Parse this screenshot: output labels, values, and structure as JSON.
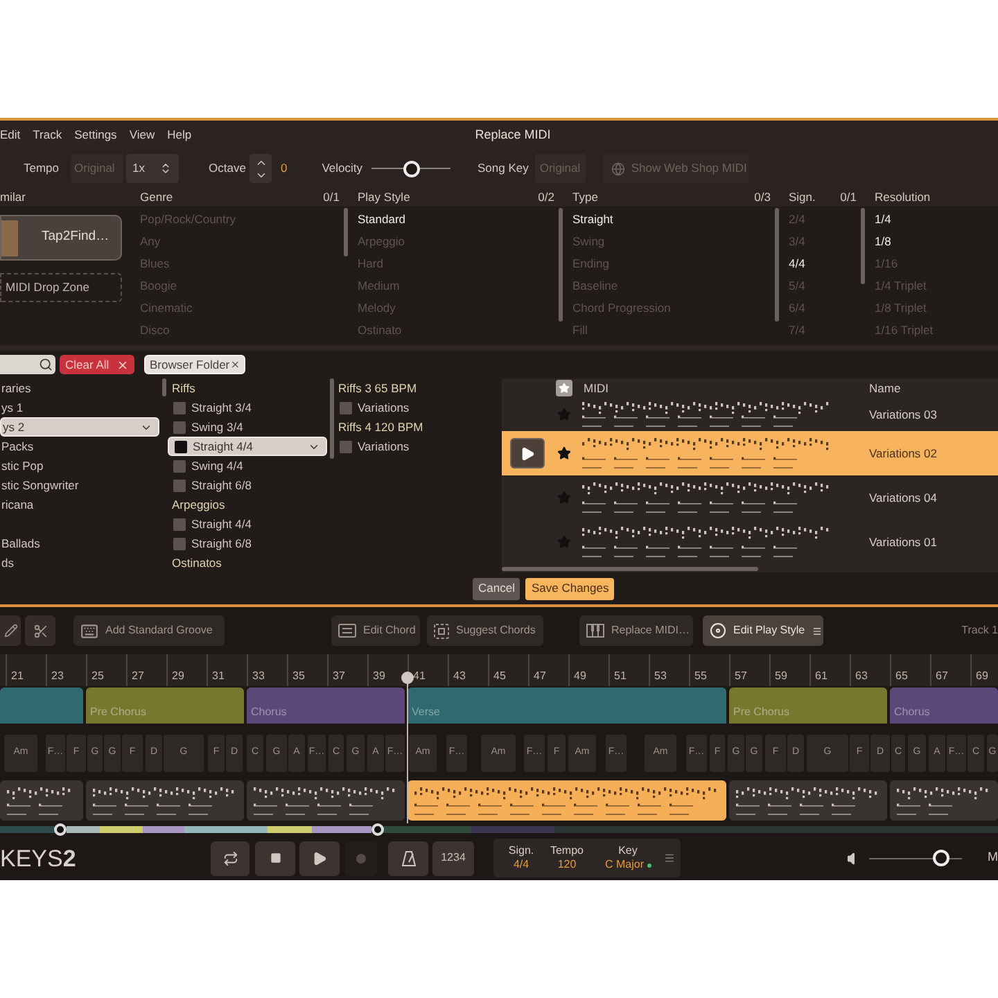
{
  "menu": [
    {
      "label": "Edit"
    },
    {
      "label": "Track"
    },
    {
      "label": "Settings"
    },
    {
      "label": "View"
    },
    {
      "label": "Help"
    }
  ],
  "window": {
    "title": "Replace MIDI"
  },
  "toolbar": {
    "tempo": {
      "label": "Tempo",
      "value": "Original",
      "disabled": true
    },
    "speed": {
      "value": "1x"
    },
    "octave": {
      "label": "Octave",
      "value": "0"
    },
    "velocity": {
      "label": "Velocity",
      "level": 0.5
    },
    "song_key": {
      "label": "Song Key",
      "value": "Original",
      "disabled": true
    },
    "web_shop_button": {
      "label": "Show Web Shop MIDI",
      "disabled": true
    }
  },
  "filters": {
    "similar": {
      "header": "milar",
      "tap_button": "Tap2Find…",
      "drop_zone": "MIDI Drop Zone"
    },
    "columns": [
      {
        "header": "Genre",
        "count": "0/1",
        "items": [
          {
            "label": "Pop/Rock/Country",
            "disabled": true
          },
          {
            "label": "Any",
            "disabled": true
          },
          {
            "label": "Blues",
            "disabled": true
          },
          {
            "label": "Boogie",
            "disabled": true
          },
          {
            "label": "Cinematic",
            "disabled": true
          },
          {
            "label": "Disco",
            "disabled": true
          }
        ]
      },
      {
        "header": "Play Style",
        "count": "0/2",
        "items": [
          {
            "label": "Standard",
            "disabled": false
          },
          {
            "label": "Arpeggio",
            "disabled": true
          },
          {
            "label": "Hard",
            "disabled": true
          },
          {
            "label": "Medium",
            "disabled": true
          },
          {
            "label": "Melody",
            "disabled": true
          },
          {
            "label": "Ostinato",
            "disabled": true
          }
        ]
      },
      {
        "header": "Type",
        "count": "0/3",
        "items": [
          {
            "label": "Straight",
            "disabled": false
          },
          {
            "label": "Swing",
            "disabled": true
          },
          {
            "label": "Ending",
            "disabled": true
          },
          {
            "label": "Baseline",
            "disabled": true
          },
          {
            "label": "Chord Progression",
            "disabled": true
          },
          {
            "label": "Fill",
            "disabled": true
          }
        ]
      },
      {
        "header": "Sign.",
        "count": "0/1",
        "items": [
          {
            "label": "2/4",
            "disabled": true
          },
          {
            "label": "3/4",
            "disabled": true
          },
          {
            "label": "4/4",
            "disabled": false
          },
          {
            "label": "5/4",
            "disabled": true
          },
          {
            "label": "6/4",
            "disabled": true
          },
          {
            "label": "7/4",
            "disabled": true
          }
        ]
      },
      {
        "header": "Resolution",
        "items": [
          {
            "label": "1/4",
            "disabled": false
          },
          {
            "label": "1/8",
            "disabled": false
          },
          {
            "label": "1/16",
            "disabled": true
          },
          {
            "label": "1/4 Triplet",
            "disabled": true
          },
          {
            "label": "1/8 Triplet",
            "disabled": true
          },
          {
            "label": "1/16 Triplet",
            "disabled": true
          }
        ]
      }
    ]
  },
  "browser": {
    "clear_button": "Clear All",
    "folder_tag": "Browser Folder",
    "columns": [
      {
        "items": [
          {
            "kind": "item",
            "label": "raries",
            "selected": false
          },
          {
            "kind": "item",
            "label": "ys 1",
            "selected": false
          },
          {
            "kind": "item",
            "label": "ys 2",
            "selected": true
          },
          {
            "kind": "item",
            "label": "Packs",
            "selected": false
          },
          {
            "kind": "item",
            "label": "stic Pop",
            "selected": false
          },
          {
            "kind": "item",
            "label": "stic Songwriter",
            "selected": false
          },
          {
            "kind": "item",
            "label": "ricana",
            "selected": false
          },
          {
            "kind": "item",
            "label": "Ballads",
            "selected": false
          },
          {
            "kind": "item",
            "label": "ds",
            "selected": false
          }
        ]
      },
      {
        "items": [
          {
            "kind": "header",
            "label": "Riffs"
          },
          {
            "kind": "folder",
            "label": "Straight 3/4",
            "selected": false
          },
          {
            "kind": "folder",
            "label": "Swing 3/4",
            "selected": false
          },
          {
            "kind": "folder",
            "label": "Straight 4/4",
            "selected": true
          },
          {
            "kind": "folder",
            "label": "Swing 4/4",
            "selected": false
          },
          {
            "kind": "folder",
            "label": "Straight 6/8",
            "selected": false
          },
          {
            "kind": "header",
            "label": "Arpeggios"
          },
          {
            "kind": "folder",
            "label": "Straight 4/4",
            "selected": false
          },
          {
            "kind": "folder",
            "label": "Straight 6/8",
            "selected": false
          },
          {
            "kind": "header",
            "label": "Ostinatos"
          }
        ]
      },
      {
        "items": [
          {
            "kind": "header",
            "label": "Riffs 3 65 BPM"
          },
          {
            "kind": "folder",
            "label": "Variations",
            "selected": false
          },
          {
            "kind": "header",
            "label": "Riffs 4 120 BPM"
          },
          {
            "kind": "folder",
            "label": "Variations",
            "selected": false
          }
        ]
      }
    ]
  },
  "midi_table": {
    "columns": [
      "MIDI",
      "Name"
    ],
    "rows": [
      {
        "name": "Variations 03",
        "selected": false
      },
      {
        "name": "Variations 02",
        "selected": true
      },
      {
        "name": "Variations 04",
        "selected": false
      },
      {
        "name": "Variations 01",
        "selected": false
      }
    ]
  },
  "dialog_buttons": [
    {
      "label": "Cancel",
      "kind": "secondary"
    },
    {
      "label": "Save Changes",
      "kind": "primary"
    }
  ],
  "main_toolbar": {
    "buttons": [
      {
        "label": "Add Standard Groove",
        "kind": "groove",
        "selected": false
      },
      {
        "label": "Edit Chord",
        "kind": "chord",
        "selected": false
      },
      {
        "label": "Suggest Chords",
        "kind": "suggest",
        "selected": false
      },
      {
        "label": "Replace MIDI…",
        "kind": "replace",
        "selected": false
      },
      {
        "label": "Edit Play Style",
        "kind": "style",
        "selected": true
      }
    ],
    "track_label": "Track 1"
  },
  "timeline": {
    "bars": [
      "21",
      "23",
      "25",
      "27",
      "29",
      "31",
      "33",
      "35",
      "37",
      "39",
      "41",
      "43",
      "45",
      "47",
      "49",
      "51",
      "53",
      "55",
      "57",
      "59",
      "61",
      "63",
      "65",
      "67",
      "69"
    ],
    "sections": [
      {
        "color": "#2e6a70"
      },
      {
        "label": "Pre Chorus",
        "color": "#77772f"
      },
      {
        "label": "Chorus",
        "color": "#5c4878"
      },
      {
        "label": "Verse",
        "color": "#2e6a70"
      },
      {
        "label": "Pre Chorus",
        "color": "#77772f"
      },
      {
        "label": "Chorus",
        "color": "#5c4878"
      }
    ],
    "chords": [
      "Am",
      "F…",
      "F",
      "G",
      "G",
      "F",
      "D",
      "G",
      "F",
      "D",
      "C",
      "G",
      "A",
      "F…",
      "C",
      "G",
      "A",
      "F…",
      "Am",
      "F…",
      "Am",
      "F…",
      "F",
      "Am",
      "F…",
      "Am",
      "F…",
      "F",
      "G",
      "G",
      "F",
      "D",
      "G",
      "F",
      "D",
      "C",
      "G",
      "A",
      "F…",
      "C",
      "G"
    ],
    "regions": [
      {
        "selected": false
      },
      {
        "selected": false
      },
      {
        "selected": false
      },
      {
        "selected": true
      },
      {
        "selected": false
      },
      {
        "selected": false
      }
    ]
  },
  "transport": {
    "logo": "KEYS**2**",
    "count_in": "1234",
    "info": [
      {
        "label": "Sign.",
        "value": "4/4"
      },
      {
        "label": "Tempo",
        "value": "120"
      },
      {
        "label": "Key",
        "value": "C Major"
      }
    ],
    "volume": {
      "level": 0.78
    },
    "edge_label": "M"
  }
}
